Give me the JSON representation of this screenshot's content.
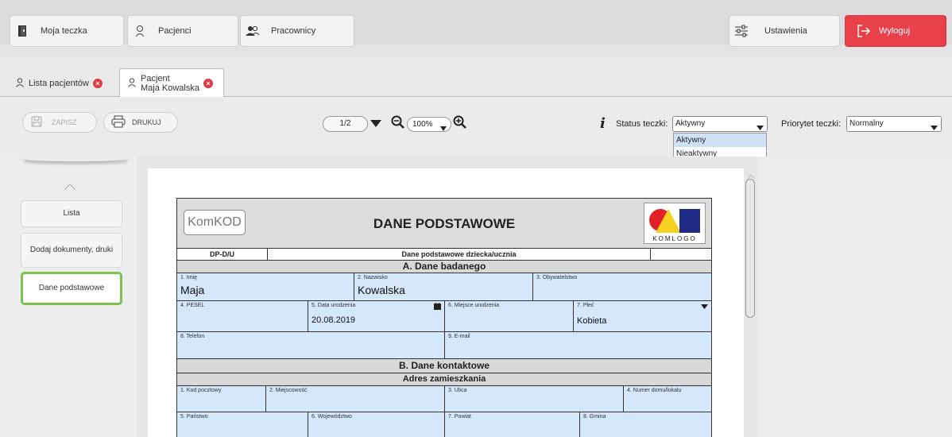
{
  "nav": {
    "my_folder": "Moja teczka",
    "patients": "Pacjenci",
    "staff": "Pracownicy",
    "settings": "Ustawienia",
    "logout": "Wyloguj"
  },
  "tabs": {
    "patient_list": "Lista pacjentów",
    "patient_tab_line1": "Pacjent",
    "patient_tab_line2": "Maja Kowalska"
  },
  "toolbar": {
    "save": "ZAPISZ",
    "print": "DRUKUJ",
    "page": "1/2",
    "zoom": "100%",
    "status_label": "Status teczki:",
    "status_value": "Aktywny",
    "status_options": [
      "Aktywny",
      "Nieaktywny"
    ],
    "priority_label": "Priorytet teczki:",
    "priority_value": "Normalny"
  },
  "sidebar": {
    "items": [
      {
        "label": "Lista"
      },
      {
        "label": "Dodaj dokumenty, druki"
      },
      {
        "label": "Dane podstawowe"
      }
    ]
  },
  "form": {
    "logo_left": "KomKOD",
    "title": "DANE PODSTAWOWE",
    "logo_right": "KOMLOGO",
    "code": "DP-D/U",
    "subtitle": "Dane podstawowe dziecka/ucznia",
    "section_a": "A. Dane badanego",
    "fields": {
      "first_name_label": "1. Imię",
      "first_name_value": "Maja",
      "last_name_label": "2. Nazwisko",
      "last_name_value": "Kowalska",
      "citizenship_label": "3. Obywatelstwo",
      "pesel_label": "4. PESEL",
      "birth_date_label": "5. Data urodzenia",
      "birth_date_value": "20.08.2019",
      "birth_place_label": "6. Miejsce urodzenia",
      "sex_label": "7. Płeć",
      "sex_value": "Kobieta",
      "phone_label": "8. Telefon",
      "email_label": "9. E-mail"
    },
    "section_b": "B. Dane kontaktowe",
    "address_header": "Adres zamieszkania",
    "address": {
      "postal_code_label": "1. Kod pocztowy",
      "city_label": "2. Miejscowość",
      "street_label": "3. Ulica",
      "house_label": "4. Numer domu/lokalu",
      "country_label": "5. Państwo",
      "voivodeship_label": "6. Województwo",
      "county_label": "7. Powiat",
      "commune_label": "8. Gmina"
    }
  },
  "colors": {
    "logout_bg": "#e8414a",
    "active_green": "#7dc04b",
    "field_blue": "#d4e7fb"
  }
}
